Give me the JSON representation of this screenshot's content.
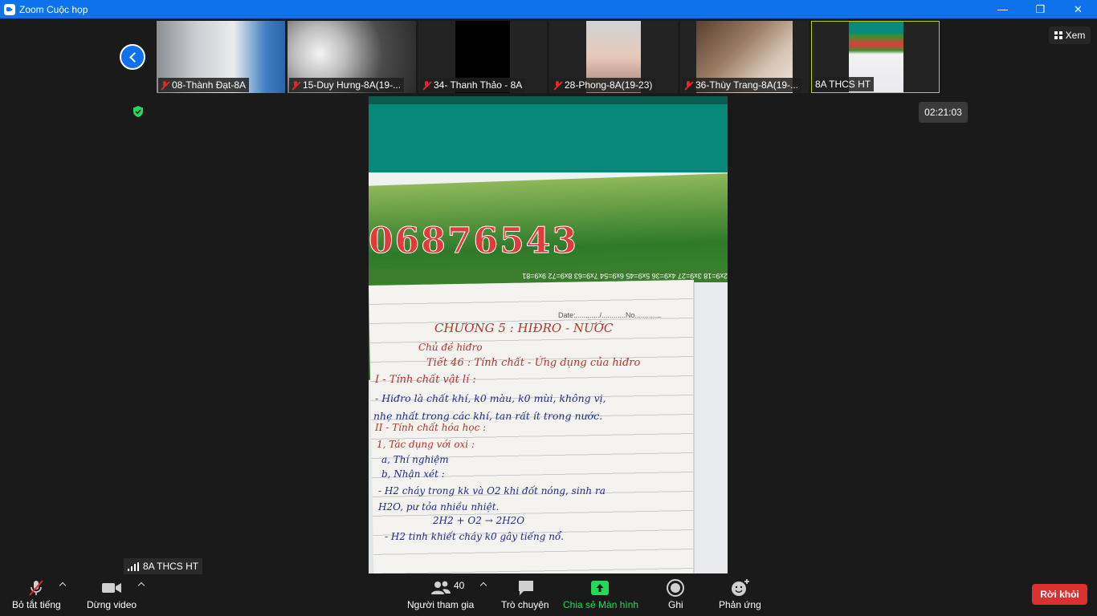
{
  "window": {
    "title": "Zoom Cuộc họp",
    "controls": {
      "minimize": "—",
      "maximize": "❐",
      "close": "✕"
    }
  },
  "participants": [
    {
      "name": "08-Thành Đạt-8A",
      "muted": true
    },
    {
      "name": "15-Duy Hưng-8A(19-...",
      "muted": true
    },
    {
      "name": "34- Thanh Thảo - 8A",
      "muted": true
    },
    {
      "name": "28-Phong-8A(19-23)",
      "muted": true
    },
    {
      "name": "36-Thùy Trang-8A(19-...",
      "muted": true
    },
    {
      "name": "8A THCS HT",
      "muted": false,
      "active": true
    }
  ],
  "view_button": {
    "label": "Xem"
  },
  "timer": {
    "text": "02:21:03"
  },
  "self_tag": {
    "name": "8A THCS HT"
  },
  "main_video": {
    "date_label": "Date:............/............No.............",
    "numbers": [
      "0",
      "6",
      "8",
      "7",
      "6",
      "5",
      "4",
      "3"
    ],
    "strip": "2x9=18  3x9=27  4x9=36  5x9=45  6x9=54  7x9=63  8x9=72  9x9=81",
    "handwriting": [
      "CHƯƠNG 5 : HIĐRO - NƯỚC",
      "Chủ đề hiđro",
      "Tiết 46 : Tính chất - Ứng dụng của hiđro",
      "I - Tính chất vật lí :",
      "- Hiđro là chất khí, k0 màu, k0 mùi, không vị,",
      "nhẹ nhất trong các khí, tan rất ít trong nước.",
      "II - Tính chất hóa học :",
      "1, Tác dụng với oxi :",
      "a, Thí nghiệm",
      "b, Nhận xét :",
      "- H2 cháy trong kk và O2 khi đốt nóng, sinh ra",
      "H2O, pư tỏa nhiều nhiệt.",
      "2H2 + O2 → 2H2O",
      "- H2 tinh khiết cháy k0 gây tiếng nổ."
    ]
  },
  "toolbar": {
    "mute": "Bỏ tắt tiếng",
    "video": "Dừng video",
    "participants_count": "40",
    "participants": "Người tham gia",
    "chat": "Trò chuyện",
    "share": "Chia sẻ Màn hình",
    "record": "Ghi",
    "reactions": "Phản ứng",
    "leave": "Rời khỏi"
  },
  "colors": {
    "title_bar": "#0e72ed",
    "share_green": "#23d959",
    "leave_red": "#d93030",
    "mute_red": "#e02828"
  }
}
